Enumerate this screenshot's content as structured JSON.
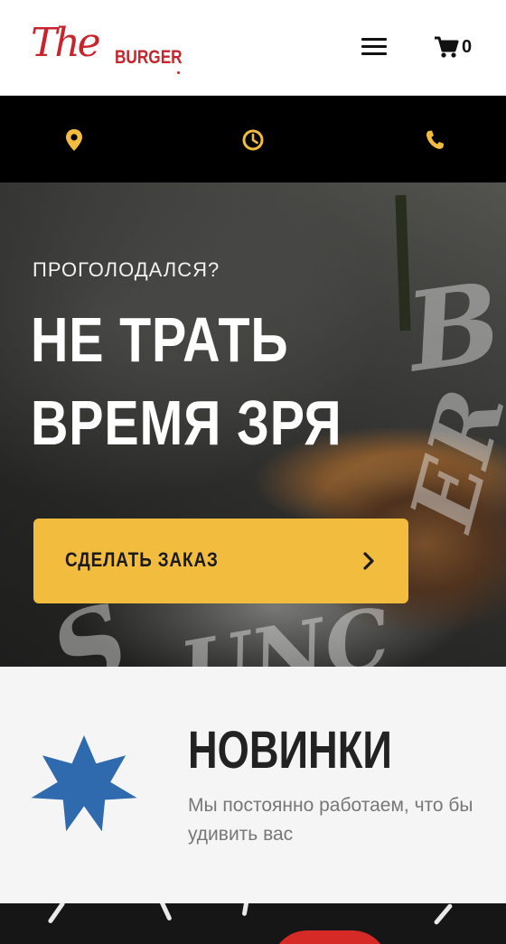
{
  "header": {
    "logo_script": "The",
    "logo_word": "BURGER",
    "cart_count": "0"
  },
  "infobar": {
    "icons": [
      "location-pin-icon",
      "clock-icon",
      "phone-icon"
    ],
    "icon_color": "#f2bd3e"
  },
  "hero": {
    "subtitle": "ПРОГОЛОДАЛСЯ?",
    "title_line1": "НЕ ТРАТЬ",
    "title_line2": "ВРЕМЯ ЗРЯ",
    "order_button": "СДЕЛАТЬ ЗАКАЗ"
  },
  "news": {
    "title": "НОВИНКИ",
    "text": "Мы постоянно работаем, что бы удивить вас"
  },
  "colors": {
    "brand_red": "#c8242c",
    "accent_yellow": "#f2bd3e",
    "star_blue": "#2f6aae"
  }
}
